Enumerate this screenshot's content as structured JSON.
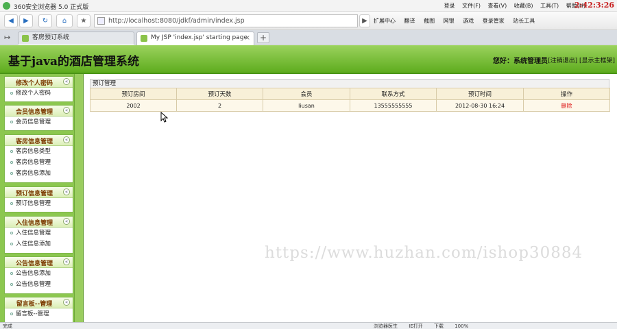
{
  "browser": {
    "title": "360安全浏览器 5.0 正式版",
    "menu": [
      "登录",
      "文件(F)",
      "查看(V)",
      "收藏(B)",
      "工具(T)",
      "帮助(H)"
    ],
    "clock": "2:42:3:26",
    "address": "http://localhost:8080/jdkf/admin/index.jsp",
    "toolbar": [
      "扩展中心",
      "翻译",
      "截图",
      "网银",
      "游戏",
      "登录管家",
      "站长工具"
    ],
    "tabs": [
      {
        "label": "客房预订系统",
        "active": false
      },
      {
        "label": "My JSP 'index.jsp' starting page",
        "active": true
      }
    ],
    "status_left": "完成",
    "status_right": [
      "浏览器医生",
      "IE打开",
      "下载",
      "100%"
    ]
  },
  "app": {
    "title": "基于java的酒店管理系统",
    "greeting": "您好：系统管理员",
    "logout_link": "[注销退出]",
    "home_link": "[显示主框架]"
  },
  "sidebar": {
    "groups": [
      {
        "title": "修改个人密码",
        "items": [
          "修改个人密码"
        ]
      },
      {
        "title": "会员信息管理",
        "items": [
          "会员信息管理"
        ]
      },
      {
        "title": "客房信息管理",
        "items": [
          "客房信息类型",
          "客房信息管理",
          "客房信息添加"
        ]
      },
      {
        "title": "预订信息管理",
        "items": [
          "预订信息管理"
        ]
      },
      {
        "title": "入住信息管理",
        "items": [
          "入住信息管理",
          "入住信息添加"
        ]
      },
      {
        "title": "公告信息管理",
        "items": [
          "公告信息添加",
          "公告信息管理"
        ]
      },
      {
        "title": "留言板--管理",
        "items": [
          "留言板--管理"
        ]
      }
    ]
  },
  "main": {
    "panel_title": "预订管理",
    "columns": [
      "预订房间",
      "预订天数",
      "会员",
      "联系方式",
      "预订时间",
      "操作"
    ],
    "rows": [
      {
        "room": "2002",
        "days": "2",
        "member": "liusan",
        "phone": "13555555555",
        "time": "2012-08-30 16:24",
        "action": "删除"
      }
    ]
  },
  "watermark": "https://www.huzhan.com/ishop30884"
}
